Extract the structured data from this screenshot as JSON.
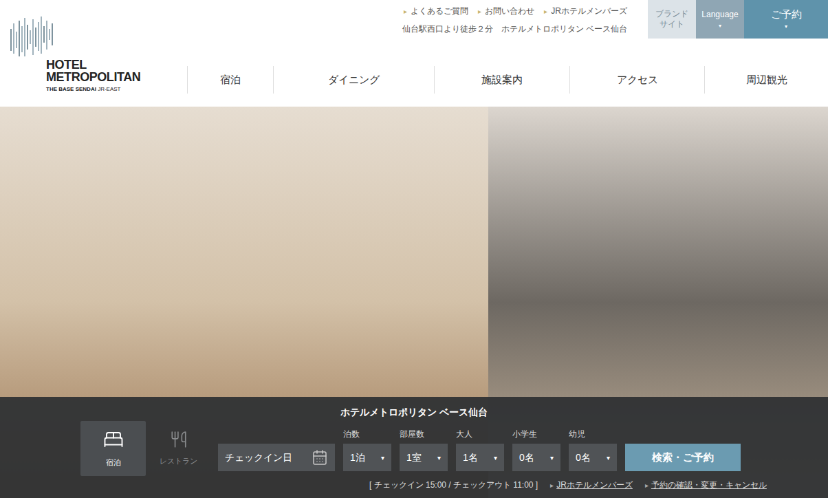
{
  "header": {
    "logo": {
      "line1": "HOTEL",
      "line2": "METROPOLITAN",
      "line3": "THE BASE SENDAI",
      "line4": "JR-EAST"
    },
    "utility_links": [
      {
        "marker": "▸",
        "label": "よくあるご質問"
      },
      {
        "marker": "▸",
        "label": "お問い合わせ"
      },
      {
        "marker": "▸",
        "label": "JRホテルメンバーズ"
      }
    ],
    "tagline": "仙台駅西口より徒歩２分　ホテルメトロポリタン ベース仙台",
    "buttons": [
      {
        "lines": [
          "ブランド",
          "サイト"
        ],
        "arrow": ""
      },
      {
        "lines": [
          "Language"
        ],
        "arrow": "▾"
      },
      {
        "lines": [
          "ご予約"
        ],
        "arrow": "▾"
      }
    ]
  },
  "nav": [
    "宿泊",
    "ダイニング",
    "施設案内",
    "アクセス",
    "周辺観光"
  ],
  "booking": {
    "title": "ホテルメトロポリタン ベース仙台",
    "modes": [
      {
        "label": "宿泊",
        "kind": "stay",
        "selected": true
      },
      {
        "label": "レストラン",
        "kind": "restaurant",
        "selected": false
      }
    ],
    "checkin": {
      "placeholder": "チェックイン日"
    },
    "select_arrow": "▾",
    "selects": [
      {
        "label": "泊数",
        "value": "1泊"
      },
      {
        "label": "部屋数",
        "value": "1室"
      },
      {
        "label": "大人",
        "value": "1名"
      },
      {
        "label": "小学生",
        "value": "0名"
      },
      {
        "label": "幼児",
        "value": "0名"
      }
    ],
    "submit": "検索・ご予約",
    "hours": "[ チェックイン 15:00 / チェックアウト 11:00 ]",
    "links": [
      {
        "marker": "▸",
        "label": "JRホテルメンバーズ"
      },
      {
        "marker": "▸",
        "label": "予約の確認・変更・キャンセル"
      }
    ]
  }
}
